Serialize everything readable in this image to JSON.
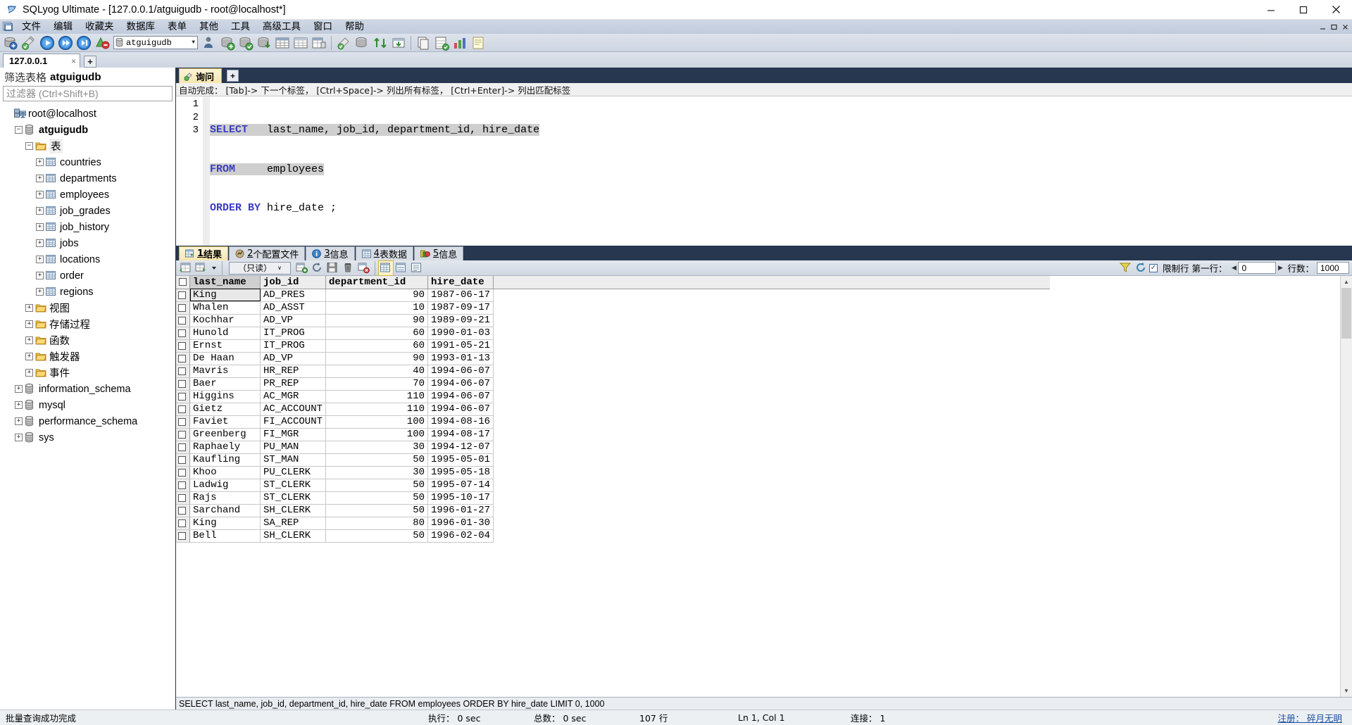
{
  "window": {
    "title": "SQLyog Ultimate - [127.0.0.1/atguigudb - root@localhost*]",
    "icon": "sqlyog-icon",
    "minimize_label": "–",
    "maximize_label": "☐",
    "close_label": "✕"
  },
  "menubar": {
    "items": [
      {
        "label": "文件"
      },
      {
        "label": "编辑"
      },
      {
        "label": "收藏夹"
      },
      {
        "label": "数据库"
      },
      {
        "label": "表单"
      },
      {
        "label": "其他"
      },
      {
        "label": "工具"
      },
      {
        "label": "高级工具"
      },
      {
        "label": "窗口"
      },
      {
        "label": "帮助"
      }
    ],
    "right_buttons": [
      "–",
      "☐",
      "✕"
    ]
  },
  "toolbar": {
    "database_selector": {
      "value": "atguigudb",
      "icon": "database-cylinder-icon",
      "arrow": "▼"
    },
    "icons": [
      "new-connection-icon",
      "refresh-object-browser-icon",
      "execute-query-icon",
      "execute-all-queries-icon",
      "execute-query-current-icon",
      "stop-query-icon"
    ],
    "icons_right": [
      "user-manager-icon",
      "backup-database-icon",
      "restore-database-icon",
      "export-database-icon",
      "schema-designer-icon",
      "table-data-icon",
      "table-diagnostics-icon",
      "query-builder-icon",
      "sync-data-icon",
      "scheduled-backup-icon",
      "import-external-data-icon",
      "migrate-icon",
      "notes-icon",
      "copy-database-icon",
      "export-csv-icon",
      "chart-icon"
    ]
  },
  "connection_tabs": {
    "tabs": [
      {
        "label": "127.0.0.1",
        "close": "×"
      }
    ],
    "add_label": "+"
  },
  "sidebar": {
    "filter_header_label": "筛选表格",
    "filter_header_db": "atguigudb",
    "filter_placeholder": "过滤器 (Ctrl+Shift+B)",
    "tree": [
      {
        "label": "root@localhost",
        "indent": 0,
        "expander": "",
        "icon": "host-icon",
        "bold": false
      },
      {
        "label": "atguigudb",
        "indent": 1,
        "expander": "−",
        "icon": "database-cylinder-icon",
        "bold": true
      },
      {
        "label": "表",
        "indent": 2,
        "expander": "−",
        "icon": "folder-icon",
        "bold": false,
        "selected": true
      },
      {
        "label": "countries",
        "indent": 3,
        "expander": "+",
        "icon": "table-icon",
        "bold": false
      },
      {
        "label": "departments",
        "indent": 3,
        "expander": "+",
        "icon": "table-icon",
        "bold": false
      },
      {
        "label": "employees",
        "indent": 3,
        "expander": "+",
        "icon": "table-icon",
        "bold": false
      },
      {
        "label": "job_grades",
        "indent": 3,
        "expander": "+",
        "icon": "table-icon",
        "bold": false
      },
      {
        "label": "job_history",
        "indent": 3,
        "expander": "+",
        "icon": "table-icon",
        "bold": false
      },
      {
        "label": "jobs",
        "indent": 3,
        "expander": "+",
        "icon": "table-icon",
        "bold": false
      },
      {
        "label": "locations",
        "indent": 3,
        "expander": "+",
        "icon": "table-icon",
        "bold": false
      },
      {
        "label": "order",
        "indent": 3,
        "expander": "+",
        "icon": "table-icon",
        "bold": false
      },
      {
        "label": "regions",
        "indent": 3,
        "expander": "+",
        "icon": "table-icon",
        "bold": false
      },
      {
        "label": "视图",
        "indent": 2,
        "expander": "+",
        "icon": "folder-icon",
        "bold": false
      },
      {
        "label": "存储过程",
        "indent": 2,
        "expander": "+",
        "icon": "folder-icon",
        "bold": false
      },
      {
        "label": "函数",
        "indent": 2,
        "expander": "+",
        "icon": "folder-icon",
        "bold": false
      },
      {
        "label": "触发器",
        "indent": 2,
        "expander": "+",
        "icon": "folder-icon",
        "bold": false
      },
      {
        "label": "事件",
        "indent": 2,
        "expander": "+",
        "icon": "folder-icon",
        "bold": false
      },
      {
        "label": "information_schema",
        "indent": 1,
        "expander": "+",
        "icon": "database-cylinder-icon",
        "bold": false
      },
      {
        "label": "mysql",
        "indent": 1,
        "expander": "+",
        "icon": "database-cylinder-icon",
        "bold": false
      },
      {
        "label": "performance_schema",
        "indent": 1,
        "expander": "+",
        "icon": "database-cylinder-icon",
        "bold": false
      },
      {
        "label": "sys",
        "indent": 1,
        "expander": "+",
        "icon": "database-cylinder-icon",
        "bold": false
      }
    ]
  },
  "query_editor": {
    "tabs": [
      {
        "label": "询问",
        "icon": "query-tab-icon",
        "active": true
      }
    ],
    "add_tab_label": "+",
    "hint": "自动完成： [Tab]-> 下一个标签， [Ctrl+Space]-> 列出所有标签， [Ctrl+Enter]-> 列出匹配标签",
    "line_numbers": [
      "1",
      "2",
      "3"
    ],
    "lines": [
      {
        "parts": [
          {
            "t": "SELECT",
            "c": "kw"
          },
          {
            "t": "   last_name, job_id, department_id, hire_date",
            "c": "txt"
          }
        ]
      },
      {
        "parts": [
          {
            "t": "FROM",
            "c": "kw"
          },
          {
            "t": "     employees",
            "c": "txt"
          }
        ]
      },
      {
        "parts": [
          {
            "t": "ORDER BY",
            "c": "kw"
          },
          {
            "t": " hire_date ;",
            "c": "txt"
          }
        ]
      }
    ],
    "sql_text_line1": "SELECT    last_name, job_id, department_id, hire_date",
    "sql_text_line2": "FROM      employees",
    "sql_text_line3": "ORDER BY  hire_date ;"
  },
  "results": {
    "tabs": [
      {
        "num": "1",
        "label": "结果",
        "icon": "result-grid-icon",
        "active": true
      },
      {
        "num": "2",
        "label": "个配置文件",
        "icon": "profile-icon",
        "active": false
      },
      {
        "num": "3",
        "label": "信息",
        "icon": "info-icon",
        "active": false
      },
      {
        "num": "4",
        "label": "表数据",
        "icon": "table-data-icon",
        "active": false
      },
      {
        "num": "5",
        "label": "信息",
        "icon": "messages-icon",
        "active": false
      }
    ],
    "toolbar": {
      "mode_value": "（只读）",
      "mode_arrow": "∨",
      "icons_left": [
        "grid-view-icon",
        "grid-export-icon",
        "dropdown-arrow-icon"
      ],
      "icons_mid": [
        "insert-row-icon",
        "refresh-data-icon",
        "save-changes-icon",
        "delete-row-icon",
        "discard-changes-icon"
      ],
      "icons_view": [
        "grid-mode-icon",
        "form-mode-icon",
        "text-mode-icon"
      ],
      "filter_icon": "filter-icon",
      "refresh_icon": "refresh-icon",
      "limit_checkbox": "✓",
      "limit_label": "限制行 第一行：",
      "offset_value": "0",
      "prev_arrow": "◀",
      "next_arrow": "▶",
      "rows_label": "行数：",
      "rows_value": "1000"
    },
    "columns": [
      "last_name",
      "job_id",
      "department_id",
      "hire_date"
    ],
    "rows": [
      [
        "King",
        "AD_PRES",
        "90",
        "1987-06-17"
      ],
      [
        "Whalen",
        "AD_ASST",
        "10",
        "1987-09-17"
      ],
      [
        "Kochhar",
        "AD_VP",
        "90",
        "1989-09-21"
      ],
      [
        "Hunold",
        "IT_PROG",
        "60",
        "1990-01-03"
      ],
      [
        "Ernst",
        "IT_PROG",
        "60",
        "1991-05-21"
      ],
      [
        "De Haan",
        "AD_VP",
        "90",
        "1993-01-13"
      ],
      [
        "Mavris",
        "HR_REP",
        "40",
        "1994-06-07"
      ],
      [
        "Baer",
        "PR_REP",
        "70",
        "1994-06-07"
      ],
      [
        "Higgins",
        "AC_MGR",
        "110",
        "1994-06-07"
      ],
      [
        "Gietz",
        "AC_ACCOUNT",
        "110",
        "1994-06-07"
      ],
      [
        "Faviet",
        "FI_ACCOUNT",
        "100",
        "1994-08-16"
      ],
      [
        "Greenberg",
        "FI_MGR",
        "100",
        "1994-08-17"
      ],
      [
        "Raphaely",
        "PU_MAN",
        "30",
        "1994-12-07"
      ],
      [
        "Kaufling",
        "ST_MAN",
        "50",
        "1995-05-01"
      ],
      [
        "Khoo",
        "PU_CLERK",
        "30",
        "1995-05-18"
      ],
      [
        "Ladwig",
        "ST_CLERK",
        "50",
        "1995-07-14"
      ],
      [
        "Rajs",
        "ST_CLERK",
        "50",
        "1995-10-17"
      ],
      [
        "Sarchand",
        "SH_CLERK",
        "50",
        "1996-01-27"
      ],
      [
        "King",
        "SA_REP",
        "80",
        "1996-01-30"
      ],
      [
        "Bell",
        "SH_CLERK",
        "50",
        "1996-02-04"
      ]
    ],
    "sql_echo": "SELECT last_name, job_id, department_id, hire_date FROM employees ORDER BY hire_date LIMIT 0, 1000"
  },
  "statusbar": {
    "message": "批量查询成功完成",
    "exec_label": "执行： 0 sec",
    "total_label": "总数： 0 sec",
    "rows_label": "107 行",
    "caret_label": "Ln 1, Col 1",
    "connection_label": "连接： 1",
    "register_link": "注册： 碎月无眀"
  }
}
